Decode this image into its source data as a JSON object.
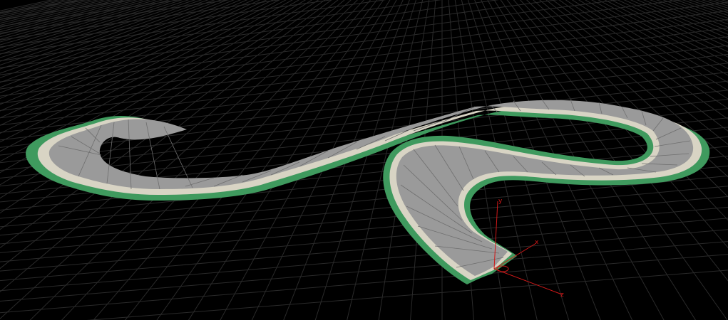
{
  "viewport": {
    "background_color": "#000000",
    "grid_color": "#2a2a2a",
    "track_surface_color": "#9a9a9a",
    "track_mesh_color": "#6e6e6e",
    "track_curb_color": "#d8d4c4",
    "track_edge_color": "#3f9a5e",
    "axis_color": "#d01818"
  },
  "gizmo": {
    "icon": "axis-gizmo-icon",
    "x_label": "x",
    "y_label": "y",
    "z_label": "z"
  }
}
